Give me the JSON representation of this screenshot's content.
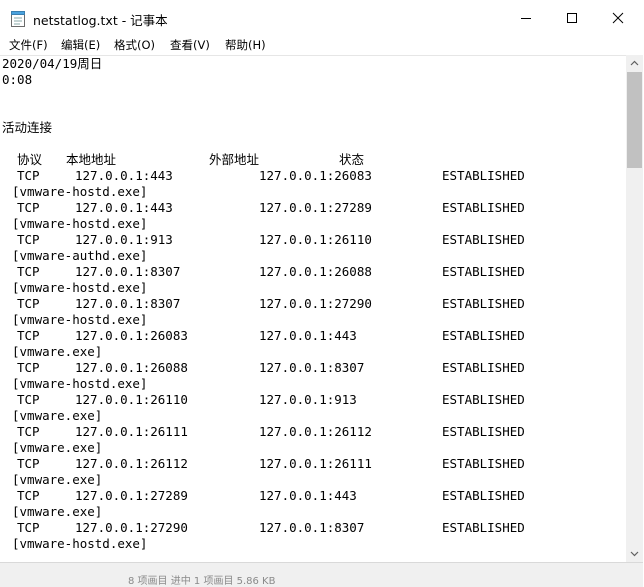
{
  "window": {
    "title": "netstatlog.txt - 记事本"
  },
  "titlebar": {
    "min_icon": "minimize-icon",
    "max_icon": "maximize-icon",
    "close_icon": "close-icon"
  },
  "menu": [
    {
      "label": "文件(F)"
    },
    {
      "label": "编辑(E)"
    },
    {
      "label": "格式(O)"
    },
    {
      "label": "查看(V)"
    },
    {
      "label": "帮助(H)"
    }
  ],
  "content": {
    "date": "2020/04/19周日",
    "time": "0:08",
    "section": "活动连接",
    "headers": {
      "proto": "协议",
      "local": "本地地址",
      "foreign": "外部地址",
      "state": "状态"
    },
    "rows": [
      {
        "proto": "TCP",
        "local": "127.0.0.1:443",
        "foreign": "127.0.0.1:26083",
        "state": "ESTABLISHED",
        "process": "[vmware-hostd.exe]"
      },
      {
        "proto": "TCP",
        "local": "127.0.0.1:443",
        "foreign": "127.0.0.1:27289",
        "state": "ESTABLISHED",
        "process": "[vmware-hostd.exe]"
      },
      {
        "proto": "TCP",
        "local": "127.0.0.1:913",
        "foreign": "127.0.0.1:26110",
        "state": "ESTABLISHED",
        "process": "[vmware-authd.exe]"
      },
      {
        "proto": "TCP",
        "local": "127.0.0.1:8307",
        "foreign": "127.0.0.1:26088",
        "state": "ESTABLISHED",
        "process": "[vmware-hostd.exe]"
      },
      {
        "proto": "TCP",
        "local": "127.0.0.1:8307",
        "foreign": "127.0.0.1:27290",
        "state": "ESTABLISHED",
        "process": "[vmware-hostd.exe]"
      },
      {
        "proto": "TCP",
        "local": "127.0.0.1:26083",
        "foreign": "127.0.0.1:443",
        "state": "ESTABLISHED",
        "process": "[vmware.exe]"
      },
      {
        "proto": "TCP",
        "local": "127.0.0.1:26088",
        "foreign": "127.0.0.1:8307",
        "state": "ESTABLISHED",
        "process": "[vmware-hostd.exe]"
      },
      {
        "proto": "TCP",
        "local": "127.0.0.1:26110",
        "foreign": "127.0.0.1:913",
        "state": "ESTABLISHED",
        "process": "[vmware.exe]"
      },
      {
        "proto": "TCP",
        "local": "127.0.0.1:26111",
        "foreign": "127.0.0.1:26112",
        "state": "ESTABLISHED",
        "process": "[vmware.exe]"
      },
      {
        "proto": "TCP",
        "local": "127.0.0.1:26112",
        "foreign": "127.0.0.1:26111",
        "state": "ESTABLISHED",
        "process": "[vmware.exe]"
      },
      {
        "proto": "TCP",
        "local": "127.0.0.1:27289",
        "foreign": "127.0.0.1:443",
        "state": "ESTABLISHED",
        "process": "[vmware.exe]"
      },
      {
        "proto": "TCP",
        "local": "127.0.0.1:27290",
        "foreign": "127.0.0.1:8307",
        "state": "ESTABLISHED",
        "process": "[vmware-hostd.exe]"
      }
    ]
  },
  "statusbar": {
    "text": "8 项画目    进中 1 项画目  5.86 KB"
  }
}
